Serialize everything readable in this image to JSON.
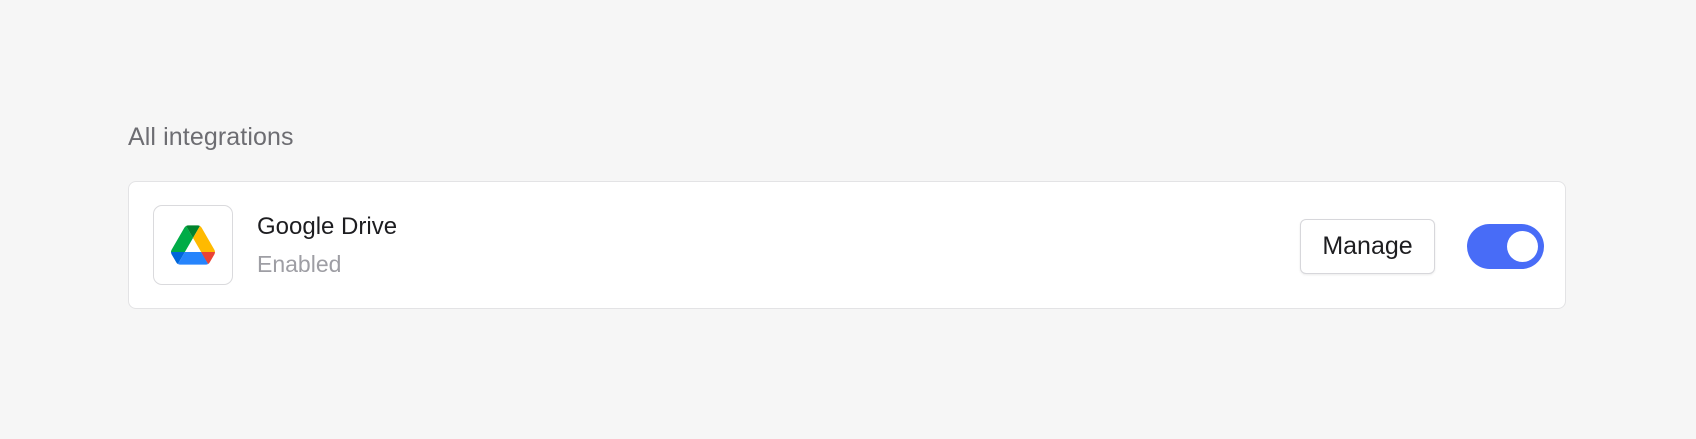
{
  "section": {
    "title": "All integrations"
  },
  "integration": {
    "name": "Google Drive",
    "status": "Enabled",
    "icon": "google-drive-icon",
    "manage_label": "Manage",
    "enabled": true
  },
  "colors": {
    "toggle_on": "#486cf7",
    "drive_green": "#0f9d58",
    "drive_yellow": "#ffba00",
    "drive_blue": "#2684fc",
    "drive_red": "#ea4335",
    "drive_dark_green": "#00832d",
    "drive_dark_blue": "#0066da"
  }
}
